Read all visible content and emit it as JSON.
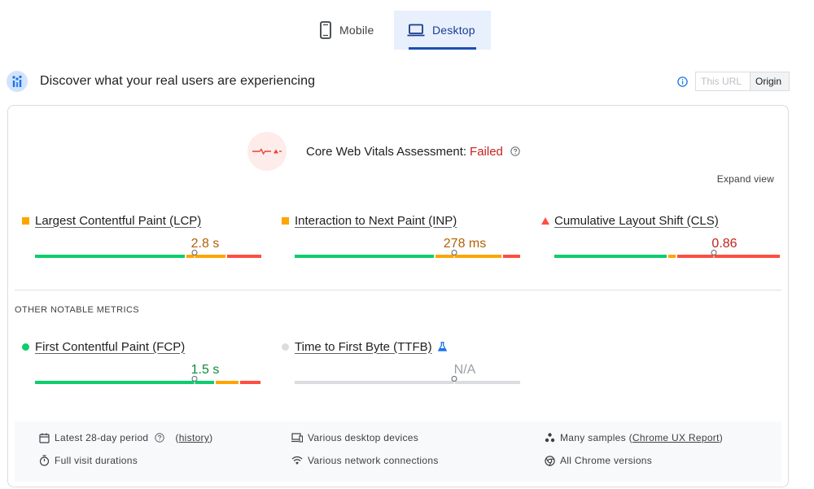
{
  "device_tabs": [
    {
      "label": "Mobile",
      "icon": "phone-icon",
      "selected": false
    },
    {
      "label": "Desktop",
      "icon": "laptop-icon",
      "selected": true
    }
  ],
  "header": {
    "title": "Discover what your real users are experiencing",
    "toggle": {
      "this_url": "This URL",
      "origin": "Origin",
      "selected": "Origin"
    }
  },
  "assessment": {
    "label": "Core Web Vitals Assessment:",
    "status": "Failed",
    "status_color": "#c5221f",
    "expand_label": "Expand view"
  },
  "core_metrics": [
    {
      "name": "Largest Contentful Paint (LCP)",
      "value": "2.8 s",
      "rating": "needs-improvement",
      "value_color": "#b45f06",
      "marker": "square",
      "marker_color": "#ffa400",
      "distribution": [
        0.67,
        0.18,
        0.15
      ],
      "percentile_position": 0.75
    },
    {
      "name": "Interaction to Next Paint (INP)",
      "value": "278 ms",
      "rating": "needs-improvement",
      "value_color": "#b45f06",
      "marker": "square",
      "marker_color": "#ffa400",
      "distribution": [
        0.625,
        0.3,
        0.075
      ],
      "percentile_position": 0.75
    },
    {
      "name": "Cumulative Layout Shift (CLS)",
      "value": "0.86",
      "rating": "poor",
      "value_color": "#c5221f",
      "marker": "triangle",
      "marker_color": "#ff4e42",
      "distribution": [
        0.505,
        0.04,
        0.455
      ],
      "percentile_position": 0.75
    }
  ],
  "other_section_label": "OTHER NOTABLE METRICS",
  "other_metrics": [
    {
      "name": "First Contentful Paint (FCP)",
      "value": "1.5 s",
      "rating": "good",
      "value_color": "#0d8a3c",
      "marker": "circle",
      "marker_color": "#0cce6b",
      "distribution": [
        0.8,
        0.11,
        0.09
      ],
      "percentile_position": 0.75,
      "experimental": false
    },
    {
      "name": "Time to First Byte (TTFB)",
      "value": "N/A",
      "rating": "none",
      "value_color": "#9aa0a6",
      "marker": "circle",
      "marker_color": "#dadce0",
      "distribution": [
        1.0
      ],
      "percentile_position": 0.75,
      "experimental": true
    }
  ],
  "footer": {
    "period": "Latest 28-day period",
    "history_open": "(",
    "history_link": "history",
    "history_close": ")",
    "devices": "Various desktop devices",
    "samples_prefix": "Many samples (",
    "samples_link": "Chrome UX Report",
    "samples_suffix": ")",
    "durations": "Full visit durations",
    "connections": "Various network connections",
    "chrome": "All Chrome versions"
  },
  "colors": {
    "good": "#0cce6b",
    "needs_improvement": "#ffa400",
    "poor": "#ff4e42",
    "none": "#dadce0",
    "accent": "#1a73e8"
  }
}
